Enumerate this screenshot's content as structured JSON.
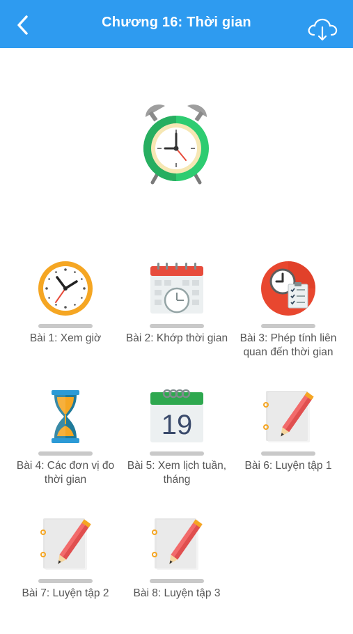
{
  "header": {
    "title": "Chương 16: Thời gian",
    "back_icon": "chevron-left-icon",
    "download_icon": "cloud-download-icon",
    "background": "#2e9bf0"
  },
  "hero_icon": "alarm-clock-icon",
  "progress_bar_color": "#c9c9c9",
  "lessons": [
    {
      "label": "Bài 1: Xem giờ",
      "icon": "clock-icon"
    },
    {
      "label": "Bài 2: Khớp thời gian",
      "icon": "calendar-clock-icon"
    },
    {
      "label": "Bài 3: Phép tính liên quan đến thời gian",
      "icon": "clock-checklist-icon"
    },
    {
      "label": "Bài 4: Các đơn vị đo thời gian",
      "icon": "hourglass-icon"
    },
    {
      "label": "Bài 5: Xem lịch tuần, tháng",
      "icon": "calendar-19-icon",
      "calendar_day": "19"
    },
    {
      "label": "Bài 6: Luyện tập 1",
      "icon": "notebook-pencil-icon"
    },
    {
      "label": "Bài 7: Luyện tập 2",
      "icon": "notebook-pencil-icon"
    },
    {
      "label": "Bài 8: Luyện tập 3",
      "icon": "notebook-pencil-icon"
    }
  ]
}
